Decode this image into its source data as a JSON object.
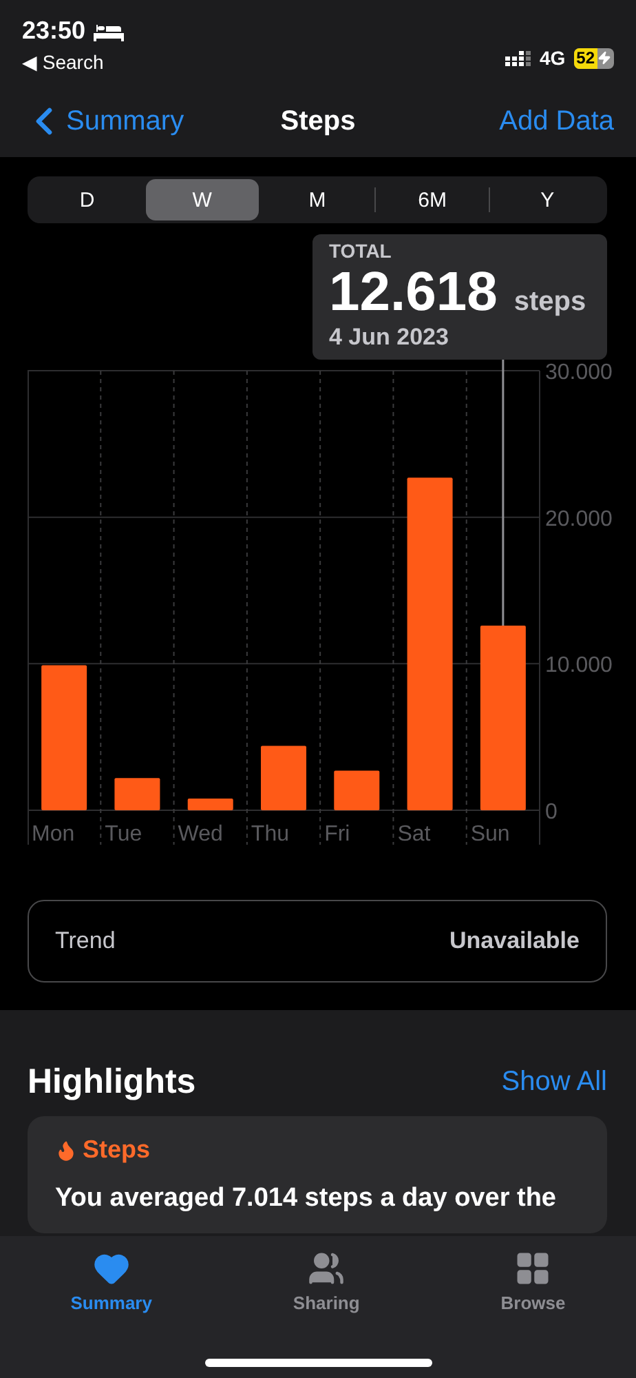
{
  "status_bar": {
    "time": "23:50",
    "back_link": "◀ Search",
    "network": "4G",
    "battery": "52"
  },
  "nav": {
    "back": "Summary",
    "title": "Steps",
    "action": "Add Data"
  },
  "periods": [
    {
      "label": "D",
      "selected": false
    },
    {
      "label": "W",
      "selected": true
    },
    {
      "label": "M",
      "selected": false
    },
    {
      "label": "6M",
      "selected": false
    },
    {
      "label": "Y",
      "selected": false
    }
  ],
  "tooltip": {
    "label": "TOTAL",
    "value": "12.618",
    "unit": "steps",
    "date": "4 Jun 2023"
  },
  "chart": {
    "chart_data": {
      "type": "bar",
      "categories": [
        "Mon",
        "Tue",
        "Wed",
        "Thu",
        "Fri",
        "Sat",
        "Sun"
      ],
      "series": [
        {
          "color": "#ff5a17",
          "values": [
            9900,
            2200,
            800,
            4400,
            2700,
            22700,
            12600
          ]
        }
      ],
      "ylim": [
        0,
        30000
      ],
      "yticks": [
        0,
        {
          "value": 10000,
          "label": "10.000"
        },
        {
          "value": 20000,
          "label": "20.000"
        },
        {
          "value": 30000,
          "label": "30.000"
        }
      ],
      "annotations": [
        {
          "x": "Sun"
        }
      ]
    }
  },
  "trend": {
    "label": "Trend",
    "value": "Unavailable"
  },
  "highlights": {
    "title": "Highlights",
    "action": "Show All",
    "card": {
      "title": "Steps",
      "text": "You averaged 7.014 steps a day over the"
    }
  },
  "tab_bar": [
    {
      "kind": "heart",
      "label": "Summary",
      "selected": true
    },
    {
      "kind": "people",
      "label": "Sharing",
      "selected": false
    },
    {
      "kind": "grid",
      "label": "Browse",
      "selected": false
    }
  ]
}
